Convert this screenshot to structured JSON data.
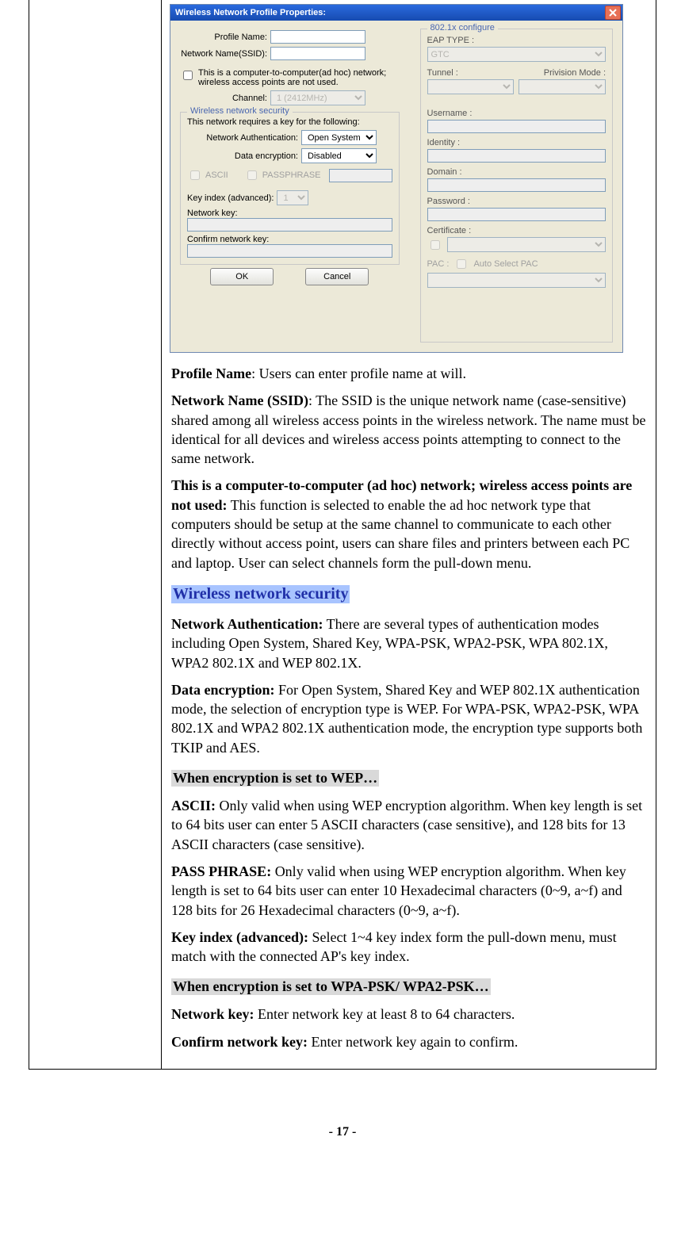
{
  "page_number": "- 17 -",
  "dialog": {
    "title": "Wireless Network Profile Properties:",
    "close_icon": "close",
    "left": {
      "profile_name_label": "Profile Name:",
      "ssid_label": "Network Name(SSID):",
      "adhoc_label": "This is a computer-to-computer(ad hoc) network; wireless access points are not used.",
      "channel_label": "Channel:",
      "channel_value": "1 (2412MHz)",
      "security_legend": "Wireless network security",
      "security_text": "This network requires a key for the following:",
      "netauth_label": "Network Authentication:",
      "netauth_value": "Open System",
      "dataenc_label": "Data encryption:",
      "dataenc_value": "Disabled",
      "ascii_label": "ASCII",
      "passphrase_label": "PASSPHRASE",
      "keyindex_label": "Key index (advanced):",
      "keyindex_value": "1",
      "netkey_label": "Network key:",
      "confirmkey_label": "Confirm network key:"
    },
    "right": {
      "legend": "802.1x configure",
      "eap_label": "EAP TYPE :",
      "eap_value": "GTC",
      "tunnel_label": "Tunnel :",
      "privmode_label": "Privision Mode :",
      "username_label": "Username :",
      "identity_label": "Identity :",
      "domain_label": "Domain :",
      "password_label": "Password :",
      "cert_label": "Certificate :",
      "pac_label": "PAC :",
      "autopac_label": "Auto Select PAC"
    },
    "buttons": {
      "ok": "OK",
      "cancel": "Cancel"
    }
  },
  "doc": {
    "p1_term": "Profile Name",
    "p1_text": ": Users can enter profile name at will.",
    "p2_term": "Network Name (SSID)",
    "p2_text": ": The SSID is the unique network name (case-sensitive) shared among all wireless access points in the wireless network. The name must be identical for all devices and wireless access points attempting to connect to the same network.",
    "p3_term": "This is a computer-to-computer (ad hoc) network; wireless access points are not used:",
    "p3_text": " This function is selected to enable the ad hoc network type that computers should be setup at the same channel to communicate to each other directly without access point, users can share files and printers between each PC and laptop. User can select channels form the pull-down menu.",
    "sec_heading": "Wireless network security",
    "p4_term": "Network Authentication:",
    "p4_text": " There are several types of authentication modes including Open System, Shared Key, WPA-PSK, WPA2-PSK, WPA 802.1X, WPA2 802.1X and WEP 802.1X.",
    "p5_term": "Data encryption:",
    "p5_text": " For Open System, Shared Key and WEP 802.1X authentication mode, the selection of encryption type is WEP. For WPA-PSK, WPA2-PSK, WPA 802.1X and WPA2 802.1X authentication mode, the encryption type supports both TKIP and AES.",
    "sub1": "When encryption is set to WEP…",
    "p6_term": "ASCII:",
    "p6_text": " Only valid when using WEP encryption algorithm. When key length is set to 64 bits user can enter 5 ASCII characters (case sensitive), and 128 bits for 13 ASCII characters (case sensitive).",
    "p7_term": "PASS PHRASE:",
    "p7_text": " Only valid when using WEP encryption algorithm. When key length is set to 64 bits user can enter 10 Hexadecimal characters (0~9, a~f) and 128 bits for 26 Hexadecimal characters (0~9, a~f).",
    "p8_term": "Key index (advanced):",
    "p8_text": " Select 1~4 key index form the pull-down menu, must match with the connected AP's key index.",
    "sub2": "When encryption is set to WPA-PSK/ WPA2-PSK…",
    "p9_term": "Network key:",
    "p9_text": " Enter network key at least 8 to 64 characters.",
    "p10_term": "Confirm network key:",
    "p10_text": " Enter network key again to confirm."
  }
}
